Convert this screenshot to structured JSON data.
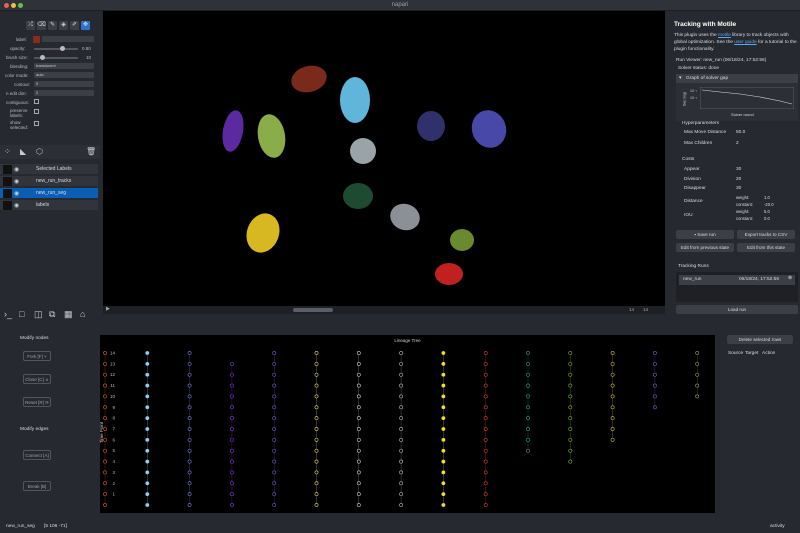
{
  "window": {
    "title": "napari"
  },
  "left_panel": {
    "controls": [
      {
        "label": "label:",
        "value": ""
      },
      {
        "label": "opacity:",
        "value": "0.80"
      },
      {
        "label": "brush size:",
        "value": "10"
      },
      {
        "label": "blending:",
        "value": "translucent"
      },
      {
        "label": "color mode:",
        "value": "auto"
      },
      {
        "label": "contour:",
        "value": "0"
      },
      {
        "label": "n edit dim:",
        "value": "2"
      },
      {
        "label": "contiguous:",
        "value": ""
      },
      {
        "label": "preserve labels:",
        "value": ""
      },
      {
        "label": "show selected:",
        "value": ""
      }
    ],
    "layers": [
      {
        "name": "Selected Labels",
        "selected": false
      },
      {
        "name": "new_run_tracks",
        "selected": false
      },
      {
        "name": "new_run_seg",
        "selected": true
      },
      {
        "name": "labels",
        "selected": false
      }
    ]
  },
  "right_panel": {
    "heading": "Tracking with Motile",
    "description_1": "This plugin uses the",
    "motile_link": "motile",
    "description_2": "library to track objects with global optimization. See the",
    "user_guide_link": "user guide",
    "description_3": "for a tutorial to the plugin functionality.",
    "run_viewer": "Run Viewer: new_run (06/18/24, 17:52:56)",
    "solver_status": "Solver status: done",
    "graph_header": "Graph of solver gap",
    "graph_xlabel": "Solver round",
    "graph_ylabel": "Gap (log)",
    "graph_yticks": [
      "10⁻¹",
      "10⁻²"
    ],
    "hyperparams_title": "Hyperparameters",
    "max_move_label": "Max Move Distance",
    "max_move_value": "50.0",
    "max_children_label": "Max Children",
    "max_children_value": "2",
    "costs_title": "Costs",
    "appear_label": "Appear",
    "appear_value": "30",
    "division_label": "Division",
    "division_value": "20",
    "disappear_label": "Disappear",
    "disappear_value": "30",
    "distance_label": "Distance",
    "distance_weight_label": "weight:",
    "distance_weight": "1.0",
    "distance_constant_label": "constant:",
    "distance_constant": "-20.0",
    "iou_label": "IOU",
    "iou_weight_label": "weight:",
    "iou_weight": "5.0",
    "iou_constant_label": "constant:",
    "iou_constant": "0.0",
    "save_run": "Save run",
    "export_csv": "Export tracks to CSV",
    "edit_prev": "Edit from previous state",
    "edit_this": "Edit from this state",
    "tracking_runs_title": "Tracking Runs",
    "run_name": "new_run",
    "run_time": "06/18/24, 17:52:56",
    "load_run": "Load run"
  },
  "canvas": {
    "frame_readout": "14",
    "frame_total": "14"
  },
  "bottom": {
    "modify_nodes": "Modify nodes",
    "fork": "Fork [F] ⑂",
    "close": "Close [C] ⨯",
    "reset": "Reset [R] ⟳",
    "modify_edges": "Modify edges",
    "connect": "Connect [A]",
    "break": "Break [B]",
    "delete_rows": "Delete selected rows",
    "table_headers": [
      "Source",
      "Target",
      "Action"
    ]
  },
  "chart_data": {
    "type": "scatter",
    "title": "Lineage Tree",
    "ylabel": "Time Point",
    "yticks": [
      1,
      2,
      3,
      4,
      5,
      6,
      7,
      8,
      9,
      10,
      11,
      12,
      13,
      14
    ],
    "ylim": [
      0,
      14
    ],
    "lineages": [
      {
        "color": "#e05a3a",
        "times": [
          0,
          1,
          2,
          3,
          4,
          5,
          6,
          7,
          8,
          9,
          10,
          11,
          12,
          13,
          14
        ],
        "filled": false
      },
      {
        "color": "#8fcff0",
        "times": [
          0,
          1,
          2,
          3,
          4,
          5,
          6,
          7,
          8,
          9,
          10,
          11,
          12,
          13,
          14
        ],
        "filled": true
      },
      {
        "color": "#7a7fe0",
        "times": [
          0,
          1,
          2,
          3,
          4,
          5,
          6,
          7,
          8,
          9,
          10,
          11,
          12,
          13,
          14
        ],
        "filled": false
      },
      {
        "color": "#7b3ae0",
        "times": [
          0,
          1,
          2,
          3,
          4,
          5,
          6,
          7,
          8,
          9,
          10,
          11,
          12,
          13
        ],
        "filled": false
      },
      {
        "color": "#6a5fd0",
        "times": [
          0,
          1,
          2,
          3,
          4,
          5,
          6,
          7,
          8,
          9,
          10,
          11,
          12,
          13,
          14
        ],
        "filled": false
      },
      {
        "color": "#e8e070",
        "times": [
          0,
          1,
          2,
          3,
          4,
          5,
          6,
          7,
          8,
          9,
          10,
          11,
          12,
          13,
          14
        ],
        "filled": false
      },
      {
        "color": "#d8d8d8",
        "times": [
          0,
          1,
          2,
          3,
          4,
          5,
          6,
          7,
          8,
          9,
          10,
          11,
          12,
          13,
          14
        ],
        "filled": false
      },
      {
        "color": "#bdbdbd",
        "times": [
          0,
          1,
          2,
          3,
          4,
          5,
          6,
          7,
          8,
          9,
          10,
          11,
          12,
          13,
          14
        ],
        "filled": false
      },
      {
        "color": "#f0e030",
        "times": [
          0,
          1,
          2,
          3,
          4,
          5,
          6,
          7,
          8,
          9,
          10,
          11,
          12,
          13,
          14
        ],
        "filled": true
      },
      {
        "color": "#e04040",
        "times": [
          0,
          1,
          2,
          3,
          4,
          5,
          6,
          7,
          8,
          9,
          10,
          11,
          12,
          13,
          14
        ],
        "filled": false
      },
      {
        "color": "#40a070",
        "times": [
          5,
          6,
          7,
          8,
          9,
          10,
          11,
          12,
          13,
          14
        ],
        "filled": false
      },
      {
        "color": "#7ab040",
        "times": [
          4,
          5,
          6,
          7,
          8,
          9,
          10,
          11,
          12,
          13,
          14
        ],
        "filled": false
      },
      {
        "color": "#d0c040",
        "times": [
          6,
          7,
          8,
          9,
          10,
          11,
          12,
          13,
          14
        ],
        "filled": false
      },
      {
        "color": "#7a60d0",
        "times": [
          9,
          10,
          11,
          12,
          13,
          14
        ],
        "filled": false
      },
      {
        "color": "#a09a70",
        "times": [
          10,
          11,
          12,
          13,
          14
        ],
        "filled": false
      }
    ]
  },
  "status": {
    "layer": "new_run_seg",
    "coords": "[5 106 -71]",
    "activity": "activity"
  }
}
